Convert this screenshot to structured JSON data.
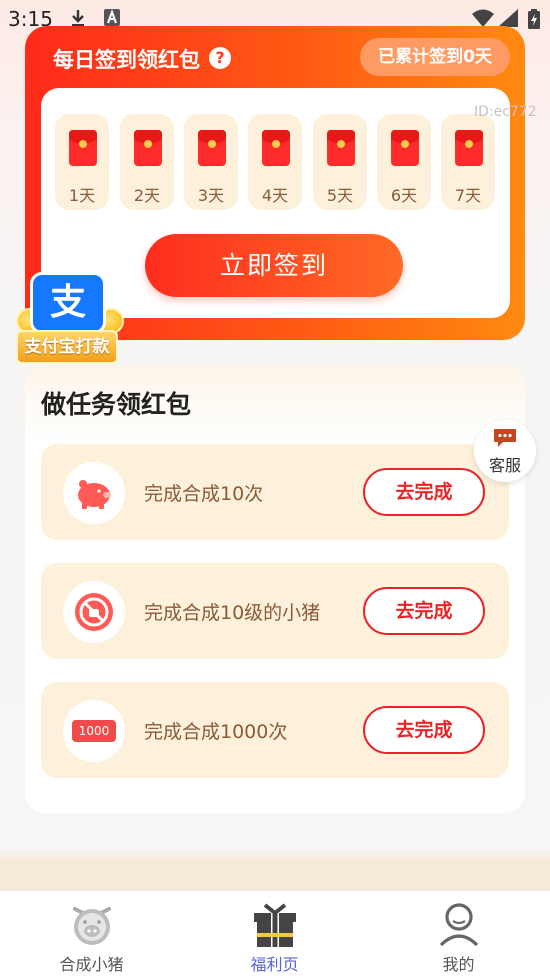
{
  "status_bar": {
    "time": "3:15"
  },
  "checkin": {
    "title": "每日签到领红包",
    "help_icon": "?",
    "count_text": "已累计签到0天",
    "days": [
      "1天",
      "2天",
      "3天",
      "4天",
      "5天",
      "6天",
      "7天"
    ],
    "button_label": "立即签到"
  },
  "watermark": "ID:ec772",
  "alipay": {
    "logo_text": "支",
    "ribbon_text": "支付宝打款"
  },
  "tasks": {
    "title": "做任务领红包",
    "items": [
      {
        "text": "完成合成10次",
        "button": "去完成",
        "icon": "piggy-icon"
      },
      {
        "text": "完成合成10级的小猪",
        "button": "去完成",
        "icon": "level-icon"
      },
      {
        "text": "完成合成1000次",
        "button": "去完成",
        "icon": "badge-1000-icon",
        "badge": "1000"
      }
    ]
  },
  "customer_service": {
    "label": "客服"
  },
  "bottom_nav": {
    "items": [
      {
        "label": "合成小猪",
        "icon": "pig-face-icon",
        "active": false
      },
      {
        "label": "福利页",
        "icon": "gift-icon",
        "active": true
      },
      {
        "label": "我的",
        "icon": "person-icon",
        "active": false
      }
    ]
  },
  "colors": {
    "brand_red": "#ff2a1a",
    "brand_orange": "#ff8a10",
    "task_bg": "#fdf1db",
    "active_nav": "#5a62d6"
  }
}
